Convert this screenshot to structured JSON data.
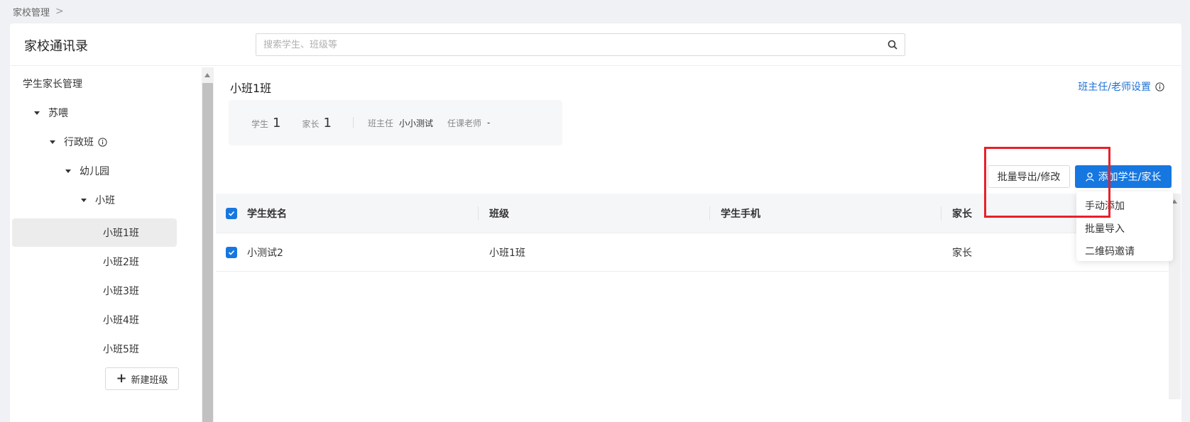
{
  "breadcrumb": {
    "root": "家校管理",
    "separator": ">"
  },
  "header": {
    "title": "家校通讯录",
    "search_placeholder": "搜索学生、班级等"
  },
  "sidebar": {
    "section_title": "学生家长管理",
    "tree": [
      {
        "label": "苏喂",
        "level": 1,
        "expanded": true
      },
      {
        "label": "行政班",
        "level": 2,
        "expanded": true,
        "has_info": true
      },
      {
        "label": "幼儿园",
        "level": 3,
        "expanded": true
      },
      {
        "label": "小班",
        "level": 4,
        "expanded": true
      }
    ],
    "classes": [
      {
        "label": "小班1班",
        "active": true
      },
      {
        "label": "小班2班"
      },
      {
        "label": "小班3班"
      },
      {
        "label": "小班4班"
      },
      {
        "label": "小班5班"
      }
    ],
    "new_class_label": "新建班级"
  },
  "main": {
    "class_title": "小班1班",
    "settings_link": "班主任/老师设置",
    "stats": {
      "student_label": "学生",
      "student_count": "1",
      "parent_label": "家长",
      "parent_count": "1",
      "head_teacher_label": "班主任",
      "head_teacher_value": "小小测试",
      "subject_teacher_label": "任课老师",
      "subject_teacher_value": "-"
    },
    "export_button": "批量导出/修改",
    "add_button": "添加学生/家长",
    "add_menu": [
      "手动添加",
      "批量导入",
      "二维码邀请"
    ],
    "table": {
      "columns": [
        "学生姓名",
        "班级",
        "学生手机",
        "家长"
      ],
      "rows": [
        {
          "name": "小测试2",
          "class": "小班1班",
          "phone": "",
          "parent": "家长"
        }
      ]
    }
  },
  "colors": {
    "accent": "#1677e0",
    "link": "#1f73d6",
    "highlight": "#e8202a"
  }
}
